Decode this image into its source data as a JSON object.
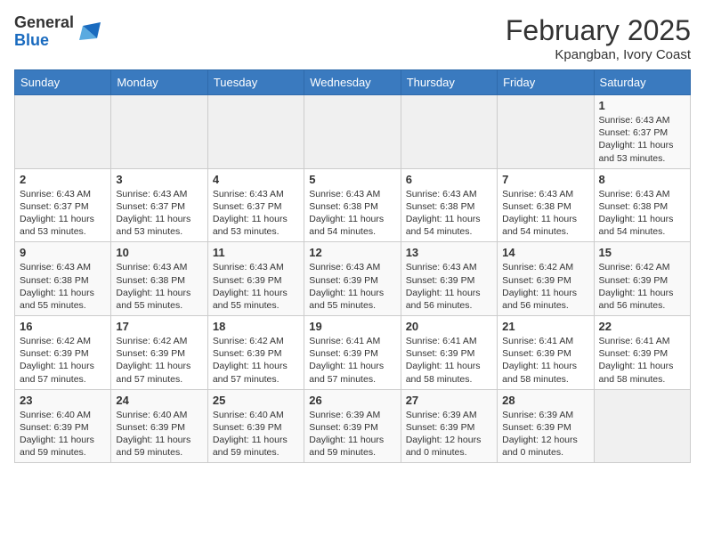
{
  "logo": {
    "general": "General",
    "blue": "Blue"
  },
  "header": {
    "month": "February 2025",
    "location": "Kpangban, Ivory Coast"
  },
  "weekdays": [
    "Sunday",
    "Monday",
    "Tuesday",
    "Wednesday",
    "Thursday",
    "Friday",
    "Saturday"
  ],
  "weeks": [
    [
      {
        "day": "",
        "info": ""
      },
      {
        "day": "",
        "info": ""
      },
      {
        "day": "",
        "info": ""
      },
      {
        "day": "",
        "info": ""
      },
      {
        "day": "",
        "info": ""
      },
      {
        "day": "",
        "info": ""
      },
      {
        "day": "1",
        "info": "Sunrise: 6:43 AM\nSunset: 6:37 PM\nDaylight: 11 hours and 53 minutes."
      }
    ],
    [
      {
        "day": "2",
        "info": "Sunrise: 6:43 AM\nSunset: 6:37 PM\nDaylight: 11 hours and 53 minutes."
      },
      {
        "day": "3",
        "info": "Sunrise: 6:43 AM\nSunset: 6:37 PM\nDaylight: 11 hours and 53 minutes."
      },
      {
        "day": "4",
        "info": "Sunrise: 6:43 AM\nSunset: 6:37 PM\nDaylight: 11 hours and 53 minutes."
      },
      {
        "day": "5",
        "info": "Sunrise: 6:43 AM\nSunset: 6:38 PM\nDaylight: 11 hours and 54 minutes."
      },
      {
        "day": "6",
        "info": "Sunrise: 6:43 AM\nSunset: 6:38 PM\nDaylight: 11 hours and 54 minutes."
      },
      {
        "day": "7",
        "info": "Sunrise: 6:43 AM\nSunset: 6:38 PM\nDaylight: 11 hours and 54 minutes."
      },
      {
        "day": "8",
        "info": "Sunrise: 6:43 AM\nSunset: 6:38 PM\nDaylight: 11 hours and 54 minutes."
      }
    ],
    [
      {
        "day": "9",
        "info": "Sunrise: 6:43 AM\nSunset: 6:38 PM\nDaylight: 11 hours and 55 minutes."
      },
      {
        "day": "10",
        "info": "Sunrise: 6:43 AM\nSunset: 6:38 PM\nDaylight: 11 hours and 55 minutes."
      },
      {
        "day": "11",
        "info": "Sunrise: 6:43 AM\nSunset: 6:39 PM\nDaylight: 11 hours and 55 minutes."
      },
      {
        "day": "12",
        "info": "Sunrise: 6:43 AM\nSunset: 6:39 PM\nDaylight: 11 hours and 55 minutes."
      },
      {
        "day": "13",
        "info": "Sunrise: 6:43 AM\nSunset: 6:39 PM\nDaylight: 11 hours and 56 minutes."
      },
      {
        "day": "14",
        "info": "Sunrise: 6:42 AM\nSunset: 6:39 PM\nDaylight: 11 hours and 56 minutes."
      },
      {
        "day": "15",
        "info": "Sunrise: 6:42 AM\nSunset: 6:39 PM\nDaylight: 11 hours and 56 minutes."
      }
    ],
    [
      {
        "day": "16",
        "info": "Sunrise: 6:42 AM\nSunset: 6:39 PM\nDaylight: 11 hours and 57 minutes."
      },
      {
        "day": "17",
        "info": "Sunrise: 6:42 AM\nSunset: 6:39 PM\nDaylight: 11 hours and 57 minutes."
      },
      {
        "day": "18",
        "info": "Sunrise: 6:42 AM\nSunset: 6:39 PM\nDaylight: 11 hours and 57 minutes."
      },
      {
        "day": "19",
        "info": "Sunrise: 6:41 AM\nSunset: 6:39 PM\nDaylight: 11 hours and 57 minutes."
      },
      {
        "day": "20",
        "info": "Sunrise: 6:41 AM\nSunset: 6:39 PM\nDaylight: 11 hours and 58 minutes."
      },
      {
        "day": "21",
        "info": "Sunrise: 6:41 AM\nSunset: 6:39 PM\nDaylight: 11 hours and 58 minutes."
      },
      {
        "day": "22",
        "info": "Sunrise: 6:41 AM\nSunset: 6:39 PM\nDaylight: 11 hours and 58 minutes."
      }
    ],
    [
      {
        "day": "23",
        "info": "Sunrise: 6:40 AM\nSunset: 6:39 PM\nDaylight: 11 hours and 59 minutes."
      },
      {
        "day": "24",
        "info": "Sunrise: 6:40 AM\nSunset: 6:39 PM\nDaylight: 11 hours and 59 minutes."
      },
      {
        "day": "25",
        "info": "Sunrise: 6:40 AM\nSunset: 6:39 PM\nDaylight: 11 hours and 59 minutes."
      },
      {
        "day": "26",
        "info": "Sunrise: 6:39 AM\nSunset: 6:39 PM\nDaylight: 11 hours and 59 minutes."
      },
      {
        "day": "27",
        "info": "Sunrise: 6:39 AM\nSunset: 6:39 PM\nDaylight: 12 hours and 0 minutes."
      },
      {
        "day": "28",
        "info": "Sunrise: 6:39 AM\nSunset: 6:39 PM\nDaylight: 12 hours and 0 minutes."
      },
      {
        "day": "",
        "info": ""
      }
    ]
  ]
}
